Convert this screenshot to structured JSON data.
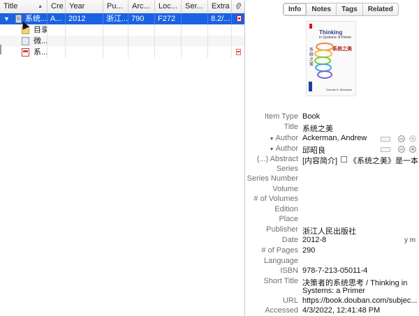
{
  "columns": [
    {
      "key": "title",
      "label": "Title"
    },
    {
      "key": "creator",
      "label": "Cre"
    },
    {
      "key": "year",
      "label": "Year"
    },
    {
      "key": "publisher",
      "label": "Pu..."
    },
    {
      "key": "archive",
      "label": "Arc..."
    },
    {
      "key": "location",
      "label": "Loc..."
    },
    {
      "key": "series",
      "label": "Ser..."
    },
    {
      "key": "extra",
      "label": "Extra"
    },
    {
      "key": "attachments",
      "label": "paperclip-icon"
    }
  ],
  "sort_indicator": "▲",
  "rows": [
    {
      "title": "系统...",
      "creator": "A...",
      "year": "2012",
      "publisher": "浙江...",
      "archive": "790",
      "location": "F272",
      "series": "",
      "extra": "8.2/..."
    },
    {
      "title": "目录"
    },
    {
      "title": "微..."
    },
    {
      "title": "系..."
    }
  ],
  "tabs": [
    "Info",
    "Notes",
    "Tags",
    "Related"
  ],
  "cover": {
    "title_en": "Thinking",
    "subtitle_en": "in Systems: A Primer",
    "title_cn": "系统之美",
    "side_text": "系统之美",
    "author": "Donella H. Meadows"
  },
  "info": {
    "item_type": {
      "label": "Item Type",
      "value": "Book"
    },
    "title": {
      "label": "Title",
      "value": "系统之美"
    },
    "author1": {
      "label": "Author",
      "value": "Ackerman, Andrew"
    },
    "author2": {
      "label": "Author",
      "value": "邱昭良"
    },
    "abstract": {
      "label": "(...) Abstract",
      "value": "[内容简介]",
      "value2": "《系统之美》是一本..."
    },
    "series": {
      "label": "Series",
      "value": ""
    },
    "series_number": {
      "label": "Series Number",
      "value": ""
    },
    "volume": {
      "label": "Volume",
      "value": ""
    },
    "num_volumes": {
      "label": "# of Volumes",
      "value": ""
    },
    "edition": {
      "label": "Edition",
      "value": ""
    },
    "place": {
      "label": "Place",
      "value": ""
    },
    "publisher": {
      "label": "Publisher",
      "value": "浙江人民出版社"
    },
    "date": {
      "label": "Date",
      "value": "2012-8",
      "ymd": "y m"
    },
    "pages": {
      "label": "# of Pages",
      "value": "290"
    },
    "language": {
      "label": "Language",
      "value": ""
    },
    "isbn": {
      "label": "ISBN",
      "value": "978-7-213-05011-4"
    },
    "short_title": {
      "label": "Short Title",
      "value": "决策者的系统思考 / Thinking in",
      "value2": "Systems: a Primer"
    },
    "url": {
      "label": "URL",
      "value": "https://book.douban.com/subjec..."
    },
    "accessed": {
      "label": "Accessed",
      "value": "4/3/2022, 12:41:48 PM"
    }
  },
  "colors": {
    "selection": "#1a62e0"
  }
}
